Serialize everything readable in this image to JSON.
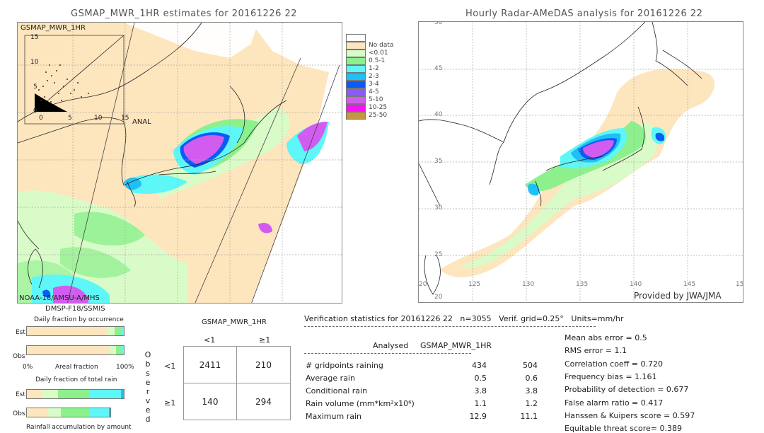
{
  "left_panel": {
    "title": "GSMAP_MWR_1HR estimates for 20161226 22",
    "scatter_label": "GSMAP_MWR_1HR",
    "scatter_y_ticks": [
      "15",
      "10",
      "5",
      "0"
    ],
    "scatter_x_ticks": [
      "0",
      "5",
      "10",
      "15"
    ],
    "scatter_x_label": "ANAL",
    "sensor_label_1": "NOAA-18/AMSU-A/MHS",
    "sensor_label_2": "DMSP-F18/SSMIS"
  },
  "right_panel": {
    "title": "Hourly Radar-AMeDAS analysis for 20161226 22",
    "lat_ticks": [
      "50",
      "45",
      "40",
      "35",
      "30",
      "25",
      "20"
    ],
    "lon_ticks": [
      "20",
      "125",
      "130",
      "135",
      "140",
      "145",
      "15"
    ],
    "credit": "Provided by JWA/JMA"
  },
  "legend": {
    "items": [
      {
        "label": "",
        "color": "#ffffff"
      },
      {
        "label": "No data",
        "color": "#fde5bd"
      },
      {
        "label": "<0.01",
        "color": "#d9fbc8"
      },
      {
        "label": "0.5-1",
        "color": "#8cf08c"
      },
      {
        "label": "1-2",
        "color": "#5ef7f7"
      },
      {
        "label": "2-3",
        "color": "#1ec0f5"
      },
      {
        "label": "3-4",
        "color": "#0a5cf5"
      },
      {
        "label": "4-5",
        "color": "#8a5cf5"
      },
      {
        "label": "5-10",
        "color": "#d25cf0"
      },
      {
        "label": "10-25",
        "color": "#f514f0"
      },
      {
        "label": "25-50",
        "color": "#c8963c"
      }
    ]
  },
  "occurrence": {
    "title": "Daily fraction by occurrence",
    "est_label": "Est",
    "obs_label": "Obs",
    "x_left": "0%",
    "x_mid": "Areal fraction",
    "x_right": "100%",
    "est_fractions": [
      0.83,
      0.075,
      0.07,
      0.025
    ],
    "obs_fractions": [
      0.855,
      0.065,
      0.055,
      0.025
    ]
  },
  "total_rain": {
    "title": "Daily fraction of total rain",
    "est_label": "Est",
    "obs_label": "Obs",
    "footer": "Rainfall accumulation by amount",
    "est_fractions": [
      0.16,
      0.16,
      0.33,
      0.32,
      0.03
    ],
    "obs_fractions": [
      0.22,
      0.14,
      0.31,
      0.2,
      0.015
    ]
  },
  "contingency": {
    "model_label": "GSMAP_MWR_1HR",
    "col_headers": [
      "<1",
      "≥1"
    ],
    "row_headers": [
      "<1",
      "≥1"
    ],
    "observed_label": [
      "O",
      "b",
      "s",
      "e",
      "r",
      "v",
      "e",
      "d"
    ],
    "cells": [
      [
        "2411",
        "210"
      ],
      [
        "140",
        "294"
      ]
    ]
  },
  "verification": {
    "header": "Verification statistics for 20161226 22   n=3055   Verif. grid=0.25°   Units=mm/hr",
    "col_analysed": "Analysed",
    "col_model": "GSMAP_MWR_1HR",
    "rows": [
      {
        "label": "# gridpoints raining",
        "analysed": "434",
        "model": "504"
      },
      {
        "label": "Average rain",
        "analysed": "0.5",
        "model": "0.6"
      },
      {
        "label": "Conditional rain",
        "analysed": "3.8",
        "model": "3.8"
      },
      {
        "label": "Rain volume (mm*km²x10⁶)",
        "analysed": "1.1",
        "model": "1.2"
      },
      {
        "label": "Maximum rain",
        "analysed": "12.9",
        "model": "11.1"
      }
    ],
    "scores": [
      "Mean abs error = 0.5",
      "RMS error = 1.1",
      "Correlation coeff = 0.720",
      "Frequency bias = 1.161",
      "Probability of detection = 0.677",
      "False alarm ratio = 0.417",
      "Hanssen & Kuipers score = 0.597",
      "Equitable threat score= 0.389"
    ]
  }
}
